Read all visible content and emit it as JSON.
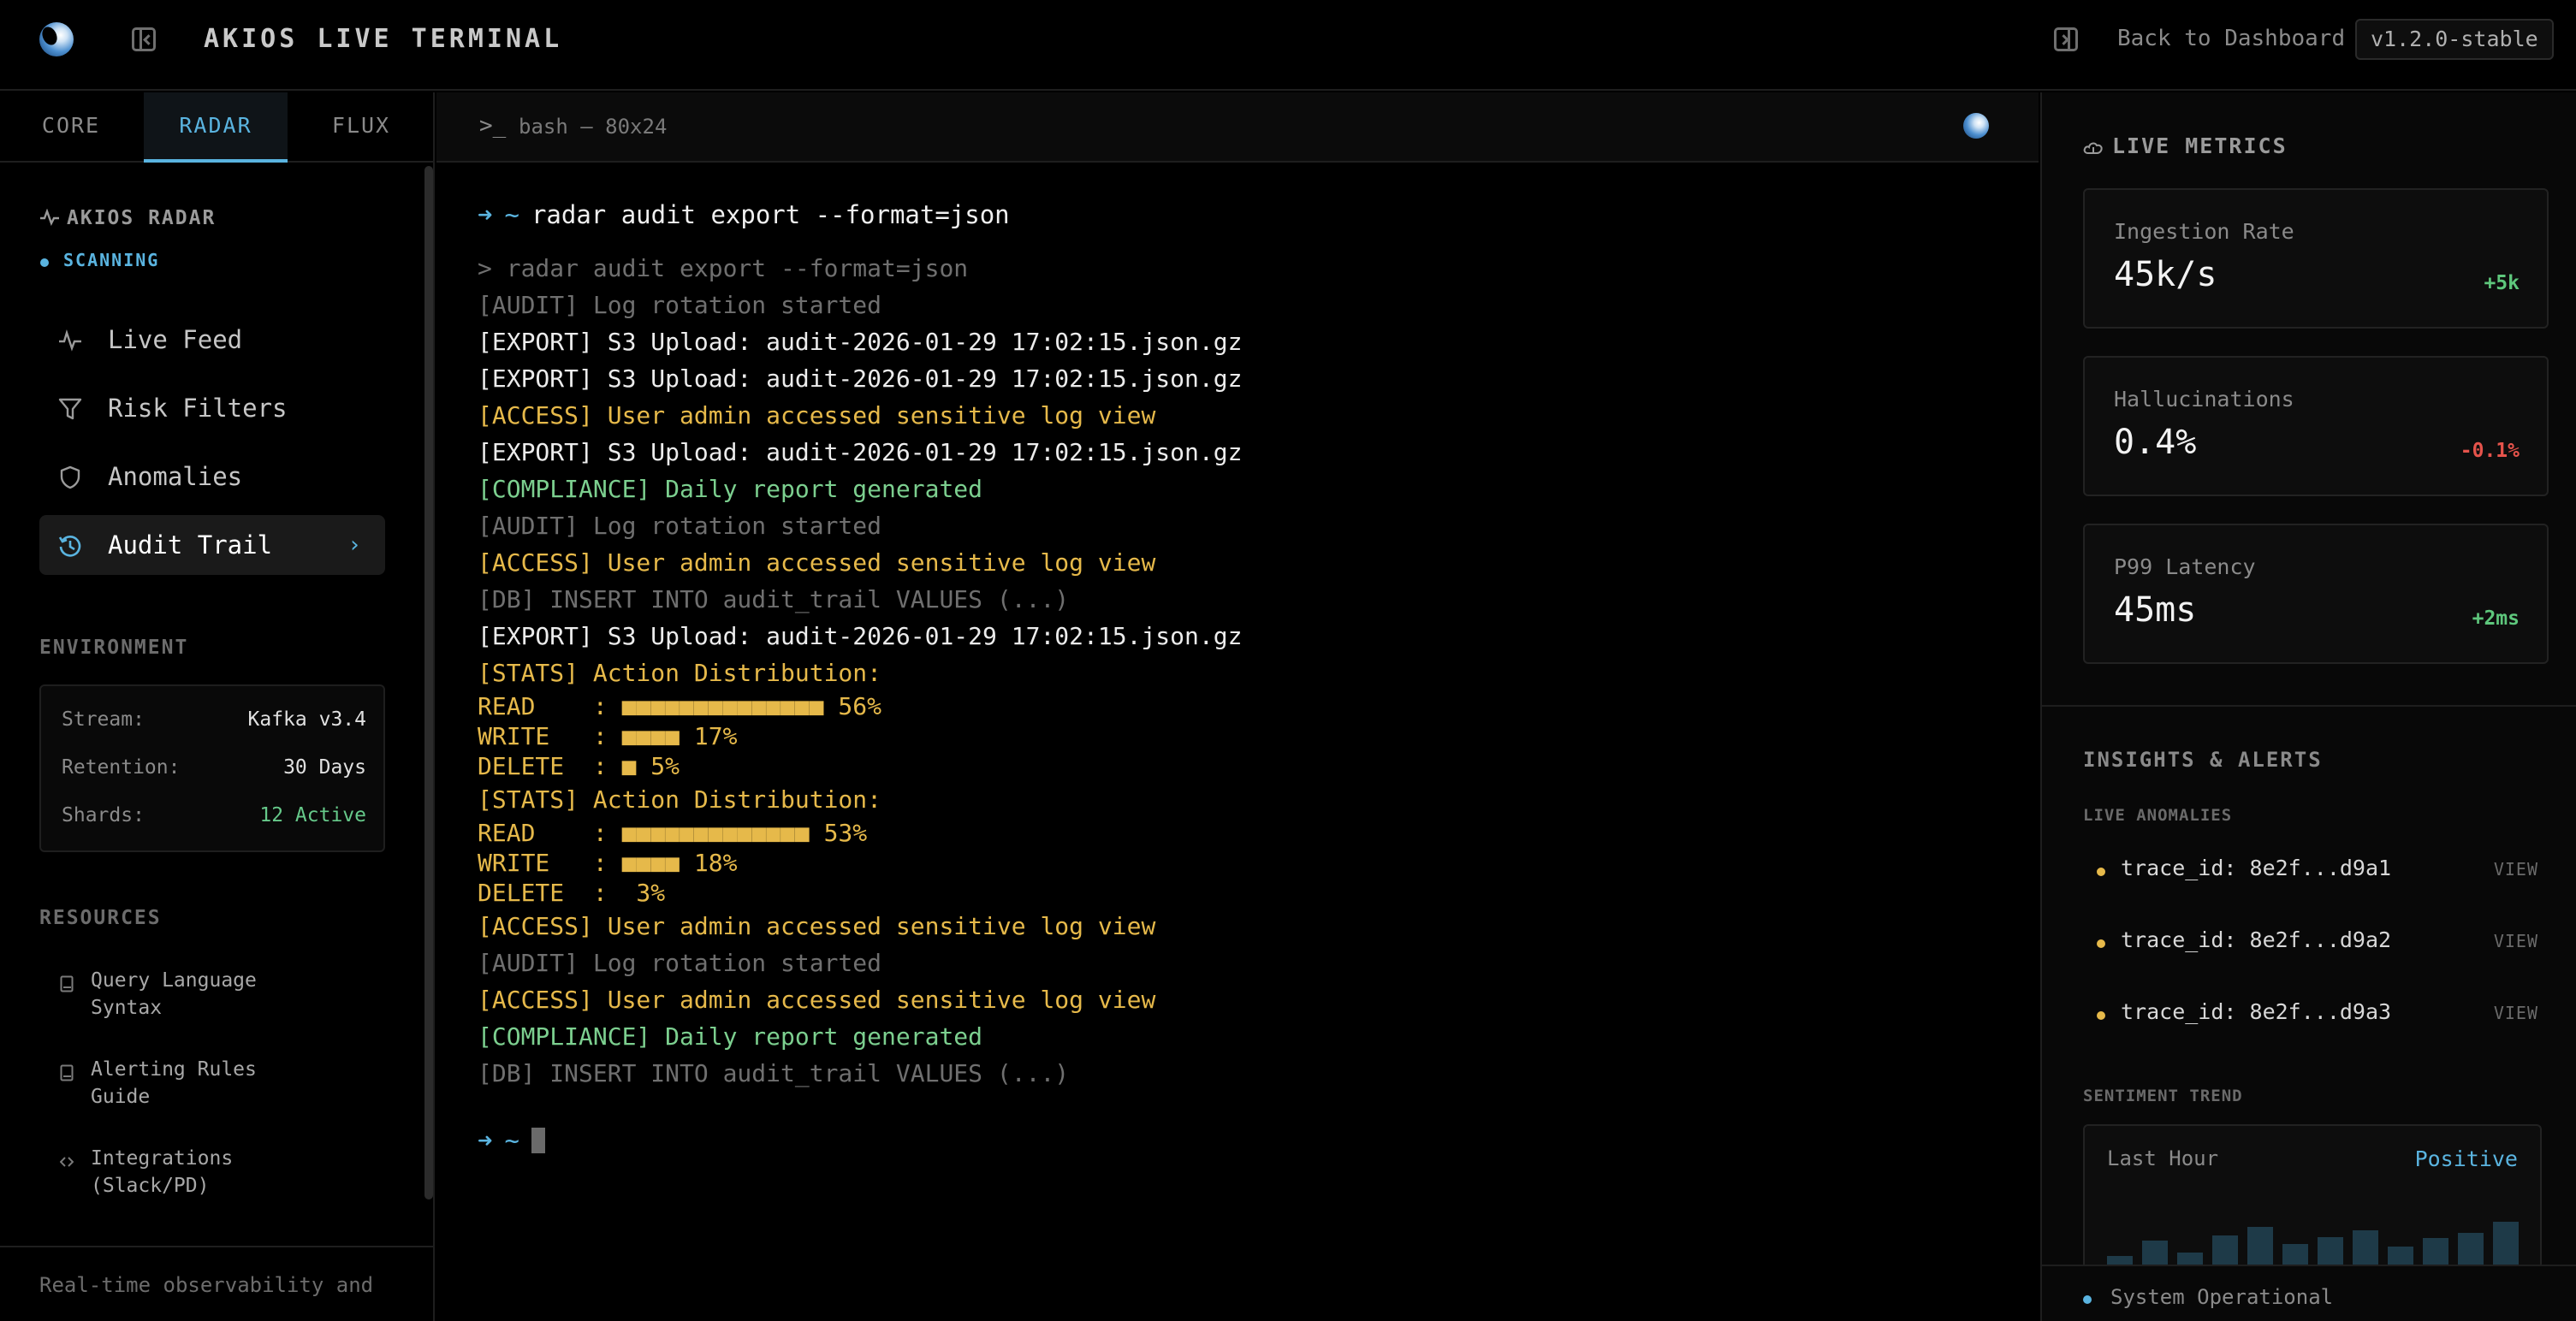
{
  "header": {
    "title": "AKIOS LIVE TERMINAL",
    "back_label": "Back to Dashboard",
    "version": "v1.2.0-stable"
  },
  "sidebar": {
    "tabs": [
      {
        "label": "CORE",
        "active": false
      },
      {
        "label": "RADAR",
        "active": true
      },
      {
        "label": "FLUX",
        "active": false
      }
    ],
    "section_title": "AKIOS RADAR",
    "status": "SCANNING",
    "nav": [
      {
        "label": "Live Feed",
        "icon": "pulse-icon"
      },
      {
        "label": "Risk Filters",
        "icon": "filter-icon"
      },
      {
        "label": "Anomalies",
        "icon": "shield-icon"
      },
      {
        "label": "Audit Trail",
        "icon": "history-icon",
        "active": true
      }
    ],
    "environment": {
      "title": "ENVIRONMENT",
      "rows": [
        {
          "key": "Stream:",
          "value": "Kafka v3.4"
        },
        {
          "key": "Retention:",
          "value": "30 Days"
        },
        {
          "key": "Shards:",
          "value": "12 Active"
        }
      ]
    },
    "resources": {
      "title": "RESOURCES",
      "items": [
        {
          "line1": "Query Language",
          "line2": "Syntax",
          "icon": "book-icon"
        },
        {
          "line1": "Alerting Rules",
          "line2": "Guide",
          "icon": "book-icon"
        },
        {
          "line1": "Integrations",
          "line2": "(Slack/PD)",
          "icon": "code-icon"
        }
      ]
    },
    "footer_text": "Real-time observability and"
  },
  "terminal": {
    "tab_title": "bash — 80x24",
    "prompt_arrow": "➜",
    "prompt_dir": "~",
    "command": "radar audit export --format=json",
    "lines": [
      {
        "text": "> radar audit export --format=json",
        "tone": "muted"
      },
      {
        "text": "[AUDIT] Log rotation started",
        "tone": "muted"
      },
      {
        "text": "[EXPORT] S3 Upload: audit-2026-01-29 17:02:15.json.gz",
        "tone": "white"
      },
      {
        "text": "[EXPORT] S3 Upload: audit-2026-01-29 17:02:15.json.gz",
        "tone": "white"
      },
      {
        "text": "[ACCESS] User admin accessed sensitive log view",
        "tone": "yellow"
      },
      {
        "text": "[EXPORT] S3 Upload: audit-2026-01-29 17:02:15.json.gz",
        "tone": "white"
      },
      {
        "text": "[COMPLIANCE] Daily report generated",
        "tone": "green"
      },
      {
        "text": "[AUDIT] Log rotation started",
        "tone": "muted"
      },
      {
        "text": "[ACCESS] User admin accessed sensitive log view",
        "tone": "yellow"
      },
      {
        "text": "[DB] INSERT INTO audit_trail VALUES (...)",
        "tone": "muted"
      },
      {
        "text": "[EXPORT] S3 Upload: audit-2026-01-29 17:02:15.json.gz",
        "tone": "white"
      },
      {
        "text": "[STATS] Action Distribution:",
        "tone": "yellow"
      },
      {
        "text": "READ    : ■■■■■■■■■■■■■■ 56%",
        "tone": "yellow",
        "stat": true
      },
      {
        "text": "WRITE   : ■■■■ 17%",
        "tone": "yellow",
        "stat": true
      },
      {
        "text": "DELETE  : ■ 5%",
        "tone": "yellow",
        "stat": true
      },
      {
        "text": "[STATS] Action Distribution:",
        "tone": "yellow"
      },
      {
        "text": "READ    : ■■■■■■■■■■■■■ 53%",
        "tone": "yellow",
        "stat": true
      },
      {
        "text": "WRITE   : ■■■■ 18%",
        "tone": "yellow",
        "stat": true
      },
      {
        "text": "DELETE  :  3%",
        "tone": "yellow",
        "stat": true
      },
      {
        "text": "[ACCESS] User admin accessed sensitive log view",
        "tone": "yellow"
      },
      {
        "text": "[AUDIT] Log rotation started",
        "tone": "muted"
      },
      {
        "text": "[ACCESS] User admin accessed sensitive log view",
        "tone": "yellow"
      },
      {
        "text": "[COMPLIANCE] Daily report generated",
        "tone": "green"
      },
      {
        "text": "[DB] INSERT INTO audit_trail VALUES (...)",
        "tone": "muted"
      }
    ]
  },
  "right_panel": {
    "live_metrics_title": "LIVE METRICS",
    "metrics": [
      {
        "label": "Ingestion Rate",
        "value": "45k/s",
        "delta": "+5k",
        "tone": "green"
      },
      {
        "label": "Hallucinations",
        "value": "0.4%",
        "delta": "-0.1%",
        "tone": "red"
      },
      {
        "label": "P99 Latency",
        "value": "45ms",
        "delta": "+2ms",
        "tone": "green"
      }
    ],
    "insights_title": "INSIGHTS & ALERTS",
    "anomalies_title": "LIVE ANOMALIES",
    "anomalies": [
      {
        "id": "trace_id: 8e2f...d9a1",
        "action": "VIEW"
      },
      {
        "id": "trace_id: 8e2f...d9a2",
        "action": "VIEW"
      },
      {
        "id": "trace_id: 8e2f...d9a3",
        "action": "VIEW"
      }
    ],
    "sentiment_title": "SENTIMENT TREND",
    "sentiment": {
      "label": "Last Hour",
      "value": "Positive",
      "levels": [
        0.3,
        0.52,
        0.35,
        0.6,
        0.72,
        0.48,
        0.58,
        0.68,
        0.44,
        0.56,
        0.64,
        0.8
      ]
    },
    "status_text": "System Operational"
  },
  "colors": {
    "accent": "#5ab4e0",
    "warning": "#e6b94a",
    "success": "#7ccf8f",
    "danger": "#e5534b"
  }
}
